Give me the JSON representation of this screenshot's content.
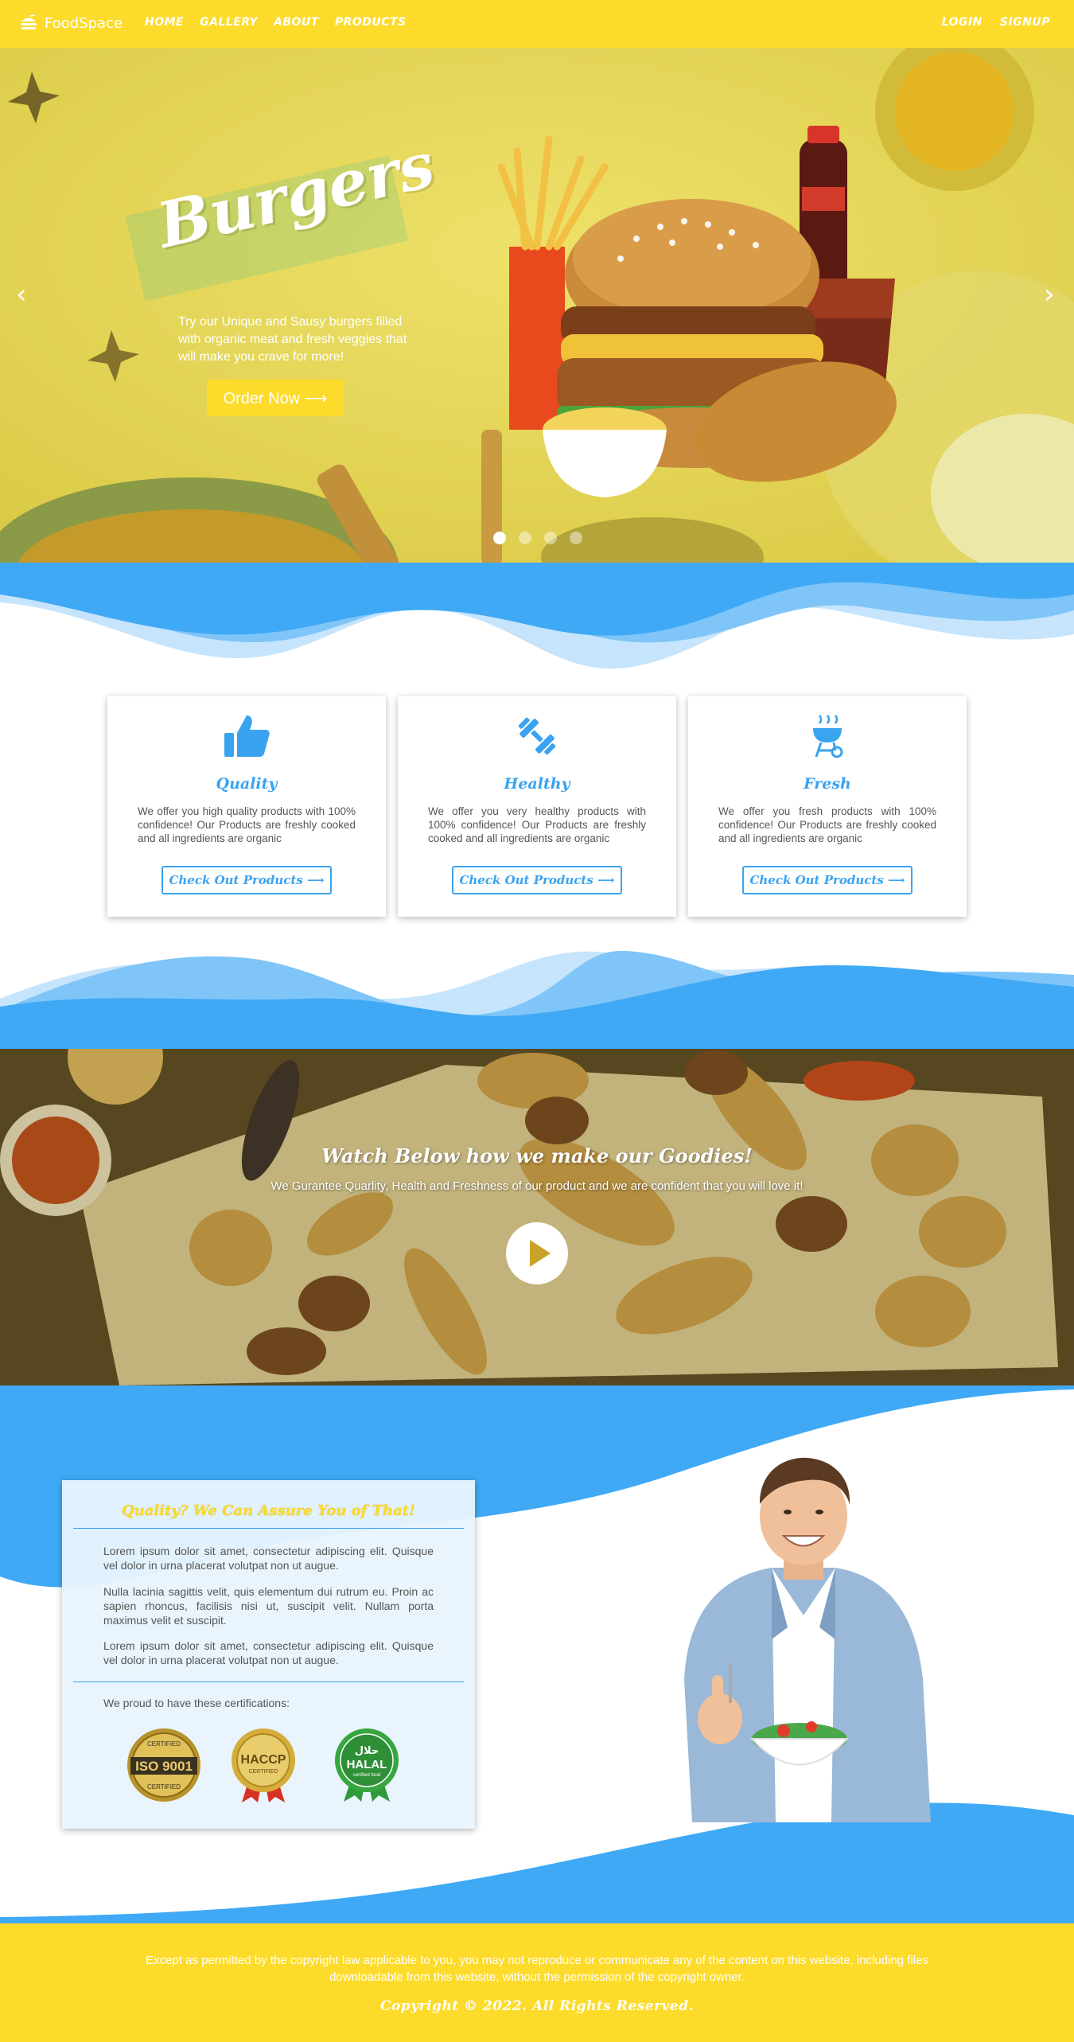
{
  "nav": {
    "brand": "FoodSpace",
    "links": [
      "HOME",
      "GALLERY",
      "ABOUT",
      "PRODUCTS"
    ],
    "login": "LOGIN",
    "signup": "SIGNUP"
  },
  "hero": {
    "title": "Burgers",
    "text": "Try our Unique and Sausy burgers filled with organic meat and fresh veggies that will make you crave for more!",
    "button": "Order Now ⟶",
    "prev_icon": "chevron-left-icon",
    "next_icon": "chevron-right-icon",
    "slides": 4,
    "active_slide": 1
  },
  "features": [
    {
      "icon": "thumbs-up-icon",
      "title": "Quality",
      "text": "We offer you high quality products with 100% confidence! Our Products are freshly cooked and all ingredients are organic",
      "button": "Check Out Products ⟶"
    },
    {
      "icon": "dumbbell-icon",
      "title": "Healthy",
      "text": "We offer you very healthy products with 100% confidence! Our Products are freshly cooked and all ingredients are organic",
      "button": "Check Out Products ⟶"
    },
    {
      "icon": "grill-icon",
      "title": "Fresh",
      "text": "We offer you fresh products with 100% confidence! Our Products are freshly cooked and all ingredients are organic",
      "button": "Check Out Products ⟶"
    }
  ],
  "video": {
    "title": "Watch Below how we make our Goodies!",
    "subtitle": "We Gurantee Quarlity, Health and Freshness of our product and we are confident that you will love it!"
  },
  "quality": {
    "title": "Quality? We Can Assure You of That!",
    "paragraphs": [
      "Lorem ipsum dolor sit amet, consectetur adipiscing elit. Quisque vel dolor in urna placerat volutpat non ut augue.",
      "Nulla lacinia sagittis velit, quis elementum dui rutrum eu. Proin ac sapien rhoncus, facilisis nisi ut, suscipit velit. Nullam porta maximus velit et suscipit.",
      "Lorem ipsum dolor sit amet, consectetur adipiscing elit. Quisque vel dolor in urna placerat volutpat non ut augue."
    ],
    "cert_text": "We proud to have these certifications:",
    "certs": [
      {
        "top": "CERTIFIED",
        "main": "ISO 9001",
        "bottom": "CERTIFIED"
      },
      {
        "top": "",
        "main": "HACCP",
        "bottom": "CERTIFIED"
      },
      {
        "top": "حلال",
        "main": "HALAL",
        "bottom": "certified food"
      }
    ]
  },
  "footer": {
    "text": "Except as permitted by the copyright law applicable to you, you may not reproduce or communicate any of the content on this website, including files downloadable from this website, without the permission of the copyright owner.",
    "copyright": "Copyright © 2022. All Rights Reserved."
  },
  "colors": {
    "yellow": "#fddb2b",
    "blue": "#3fa9f5",
    "light_blue": "#9fd3fa"
  }
}
